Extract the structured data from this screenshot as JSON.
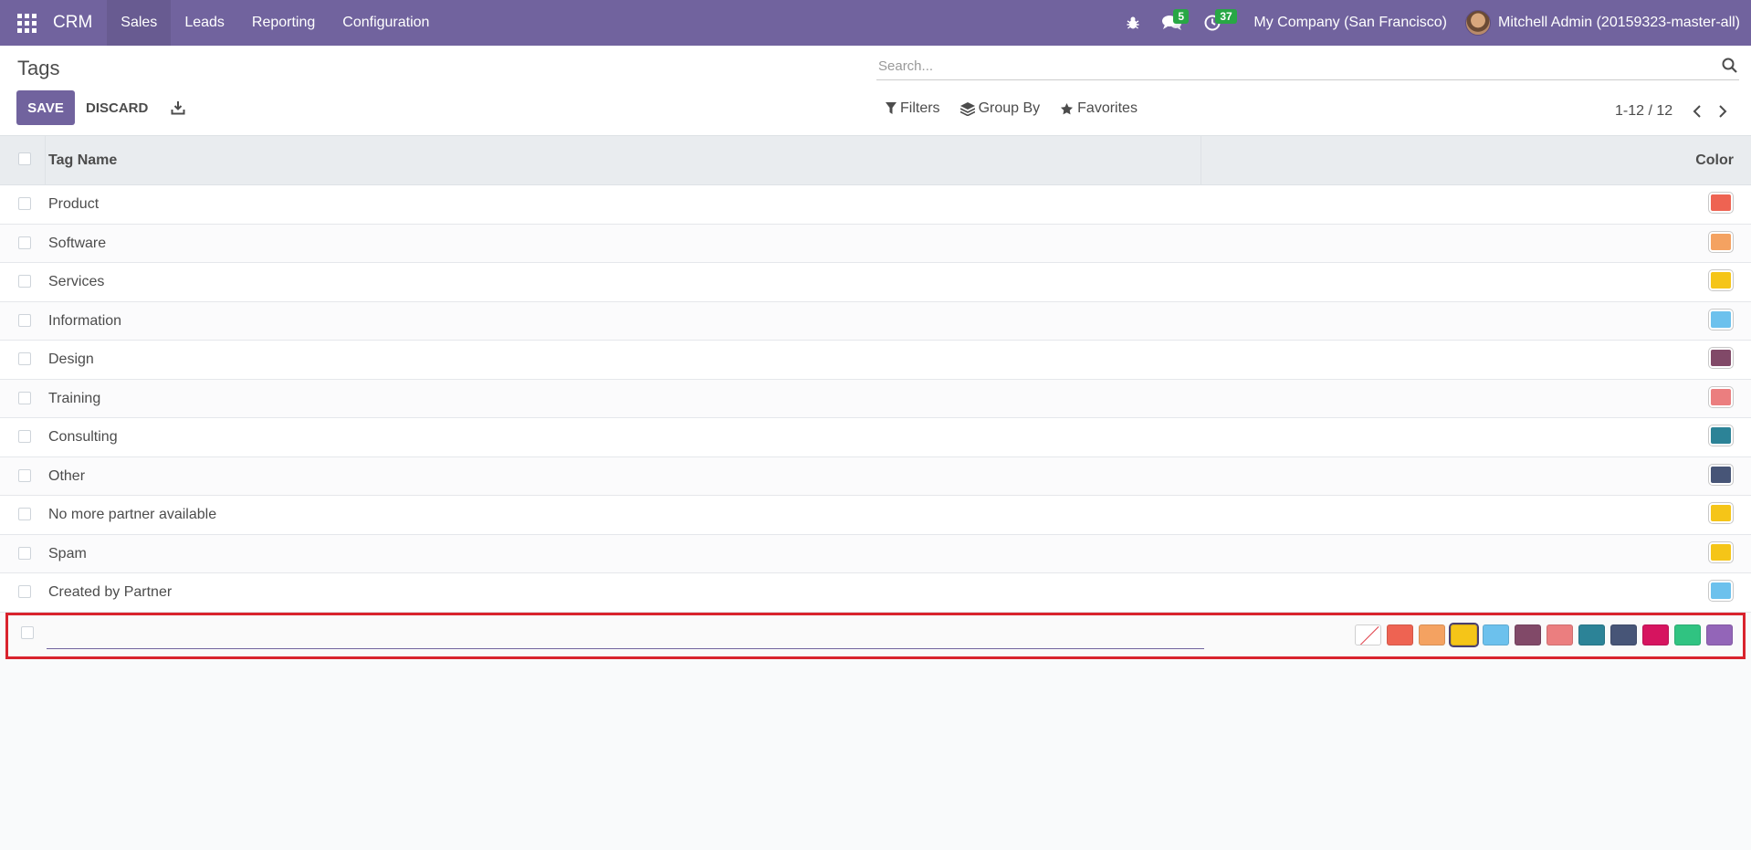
{
  "navbar": {
    "brand": "CRM",
    "menu": [
      "Sales",
      "Leads",
      "Reporting",
      "Configuration"
    ],
    "active_menu": "Sales",
    "messages_count": "5",
    "activities_count": "37",
    "company": "My Company (San Francisco)",
    "user": "Mitchell Admin (20159323-master-all)"
  },
  "control_panel": {
    "breadcrumb": "Tags",
    "save_label": "SAVE",
    "discard_label": "DISCARD",
    "search_placeholder": "Search...",
    "filters_label": "Filters",
    "group_by_label": "Group By",
    "favorites_label": "Favorites",
    "pager": "1-12 / 12"
  },
  "table": {
    "columns": [
      "Tag Name",
      "Color"
    ],
    "rows": [
      {
        "name": "Product",
        "color": "#ee6352"
      },
      {
        "name": "Software",
        "color": "#f4a261"
      },
      {
        "name": "Services",
        "color": "#f5c518"
      },
      {
        "name": "Information",
        "color": "#6cc1ed"
      },
      {
        "name": "Design",
        "color": "#814968"
      },
      {
        "name": "Training",
        "color": "#eb7e7f"
      },
      {
        "name": "Consulting",
        "color": "#2c8397"
      },
      {
        "name": "Other",
        "color": "#475577"
      },
      {
        "name": "No more partner available",
        "color": "#f5c518"
      },
      {
        "name": "Spam",
        "color": "#f5c518"
      },
      {
        "name": "Created by Partner",
        "color": "#6cc1ed"
      }
    ]
  },
  "edit_row": {
    "name_value": "",
    "palette": [
      "none",
      "#ee6352",
      "#f4a261",
      "#f5c518",
      "#6cc1ed",
      "#814968",
      "#eb7e7f",
      "#2c8397",
      "#475577",
      "#d6145f",
      "#30c381",
      "#9365b8"
    ],
    "selected_index": 3
  },
  "colors": {
    "brand": "#71639e",
    "highlight_border": "#d9232d"
  }
}
